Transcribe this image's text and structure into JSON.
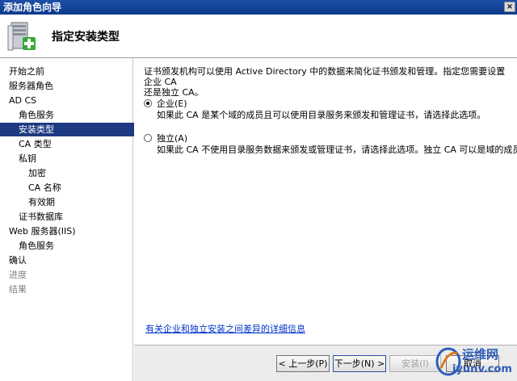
{
  "window": {
    "title": "添加角色向导",
    "close_glyph": "×"
  },
  "header": {
    "title": "指定安装类型",
    "icon": "server-wizard-icon"
  },
  "sidebar": {
    "items": [
      {
        "label": "开始之前",
        "indent": 0,
        "state": "normal"
      },
      {
        "label": "服务器角色",
        "indent": 0,
        "state": "normal"
      },
      {
        "label": "AD CS",
        "indent": 0,
        "state": "normal"
      },
      {
        "label": "角色服务",
        "indent": 1,
        "state": "normal"
      },
      {
        "label": "安装类型",
        "indent": 1,
        "state": "selected"
      },
      {
        "label": "CA 类型",
        "indent": 1,
        "state": "normal"
      },
      {
        "label": "私钥",
        "indent": 1,
        "state": "normal"
      },
      {
        "label": "加密",
        "indent": 2,
        "state": "normal"
      },
      {
        "label": "CA 名称",
        "indent": 2,
        "state": "normal"
      },
      {
        "label": "有效期",
        "indent": 2,
        "state": "normal"
      },
      {
        "label": "证书数据库",
        "indent": 1,
        "state": "normal"
      },
      {
        "label": "Web 服务器(IIS)",
        "indent": 0,
        "state": "normal"
      },
      {
        "label": "角色服务",
        "indent": 1,
        "state": "normal"
      },
      {
        "label": "确认",
        "indent": 0,
        "state": "normal"
      },
      {
        "label": "进度",
        "indent": 0,
        "state": "dim"
      },
      {
        "label": "结果",
        "indent": 0,
        "state": "dim"
      }
    ]
  },
  "main": {
    "intro_line1": "证书颁发机构可以使用 Active Directory 中的数据来简化证书颁发和管理。指定您需要设置企业 CA",
    "intro_line2": "还是独立 CA。",
    "options": [
      {
        "label": "企业(E)",
        "checked": true,
        "description": "如果此 CA 是某个域的成员且可以使用目录服务来颁发和管理证书，请选择此选项。"
      },
      {
        "label": "独立(A)",
        "checked": false,
        "description": "如果此 CA 不使用目录服务数据来颁发或管理证书，请选择此选项。独立 CA 可以是域的成员。"
      }
    ],
    "more_info_link": "有关企业和独立安装之间差异的详细信息"
  },
  "footer": {
    "back_label": "< 上一步(P)",
    "next_label": "下一步(N) >",
    "install_label": "安装(I)",
    "cancel_label": "取消"
  },
  "watermark": {
    "line1": "运维网",
    "line2": "iyunv.com"
  }
}
